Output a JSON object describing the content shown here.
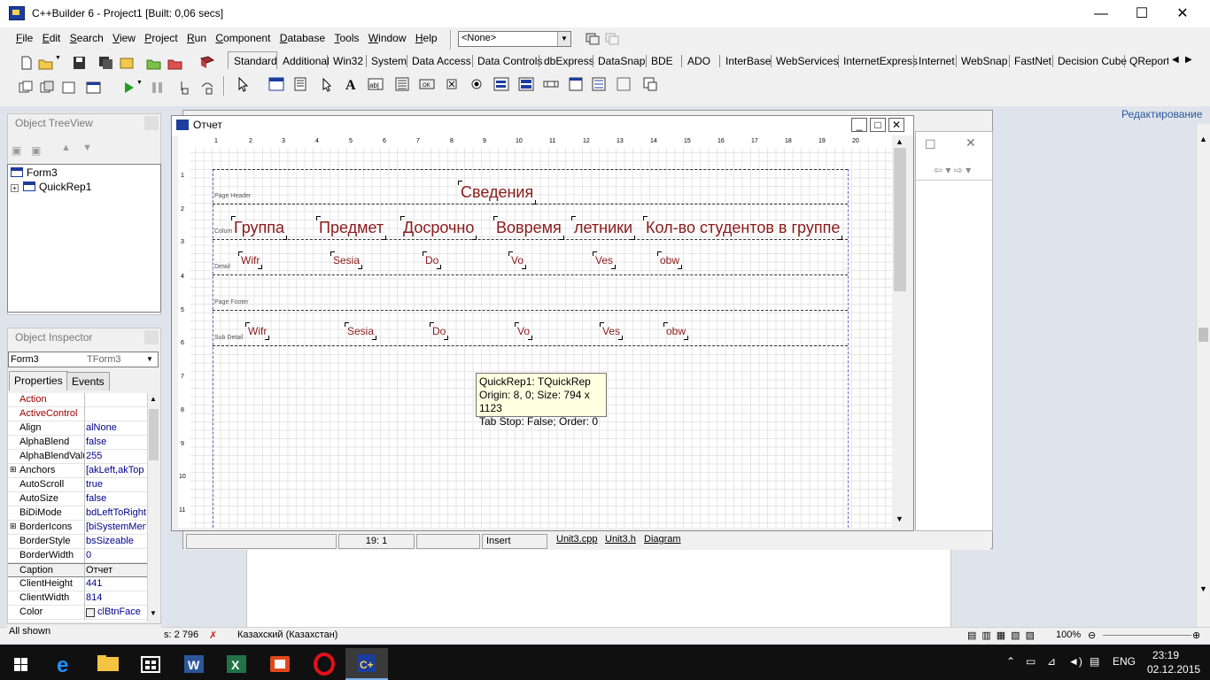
{
  "app": {
    "title": "C++Builder 6 - Project1 [Built: 0,06 secs]"
  },
  "window_buttons": {
    "minimize": "—",
    "maximize": "☐",
    "close": "✕"
  },
  "menu": [
    {
      "label": "File",
      "key": "F",
      "rest": "ile"
    },
    {
      "label": "Edit",
      "key": "E",
      "rest": "dit"
    },
    {
      "label": "Search",
      "key": "S",
      "rest": "earch"
    },
    {
      "label": "View",
      "key": "V",
      "rest": "iew"
    },
    {
      "label": "Project",
      "key": "P",
      "rest": "roject"
    },
    {
      "label": "Run",
      "key": "R",
      "rest": "un"
    },
    {
      "label": "Component",
      "key": "C",
      "rest": "omponent"
    },
    {
      "label": "Database",
      "key": "D",
      "rest": "atabase"
    },
    {
      "label": "Tools",
      "key": "T",
      "rest": "ools"
    },
    {
      "label": "Window",
      "key": "W",
      "rest": "indow"
    },
    {
      "label": "Help",
      "key": "H",
      "rest": "elp"
    }
  ],
  "config_combo": "<None>",
  "palette_tabs": [
    "Standard",
    "Additional",
    "Win32",
    "System",
    "Data Access",
    "Data Controls",
    "dbExpress",
    "DataSnap",
    "BDE",
    "ADO",
    "InterBase",
    "WebServices",
    "InternetExpress",
    "Internet",
    "WebSnap",
    "FastNet",
    "Decision Cube",
    "QReport"
  ],
  "treeview": {
    "title": "Object TreeView",
    "nodes": [
      "Form3",
      "QuickRep1"
    ]
  },
  "inspector": {
    "title": "Object Inspector",
    "object": "Form3",
    "object_type": "TForm3",
    "tabs": [
      "Properties",
      "Events"
    ],
    "props": [
      {
        "name": "Action",
        "value": "",
        "event": true
      },
      {
        "name": "ActiveControl",
        "value": "",
        "event": true
      },
      {
        "name": "Align",
        "value": "alNone"
      },
      {
        "name": "AlphaBlend",
        "value": "false"
      },
      {
        "name": "AlphaBlendValu",
        "value": "255"
      },
      {
        "name": "Anchors",
        "value": "[akLeft,akTop",
        "expandable": true
      },
      {
        "name": "AutoScroll",
        "value": "true"
      },
      {
        "name": "AutoSize",
        "value": "false"
      },
      {
        "name": "BiDiMode",
        "value": "bdLeftToRight"
      },
      {
        "name": "BorderIcons",
        "value": "[biSystemMen",
        "expandable": true
      },
      {
        "name": "BorderStyle",
        "value": "bsSizeable"
      },
      {
        "name": "BorderWidth",
        "value": "0"
      },
      {
        "name": "Caption",
        "value": "Отчет",
        "selected": true
      },
      {
        "name": "ClientHeight",
        "value": "441"
      },
      {
        "name": "ClientWidth",
        "value": "814"
      },
      {
        "name": "Color",
        "value": "clBtnFace"
      }
    ],
    "footer": "All shown"
  },
  "report_form": {
    "title": "Отчет",
    "ruler_top": [
      "1",
      "2",
      "3",
      "4",
      "5",
      "6",
      "7",
      "8",
      "9",
      "10",
      "11",
      "12",
      "13",
      "14",
      "15",
      "16",
      "17",
      "18",
      "19",
      "20"
    ],
    "ruler_left": [
      "1",
      "2",
      "3",
      "4",
      "5",
      "6",
      "7",
      "8",
      "9",
      "10",
      "11"
    ],
    "bands": {
      "page_header": "Page Header",
      "column_header": "Colum",
      "detail": "Detail",
      "page_footer": "Page Footer",
      "sub_detail": "Sub Detail"
    },
    "title_label": "Сведения",
    "column_labels": [
      "Группа",
      "Предмет",
      "Досрочно",
      "Вовремя",
      "летники",
      "Кол-во студентов в группе"
    ],
    "detail_fields": [
      "Wifr",
      "Sesia",
      "Do",
      "Vo",
      "Ves",
      "obw"
    ],
    "subdetail_fields": [
      "Wifr",
      "Sesia",
      "Do",
      "Vo",
      "Ves",
      "obw"
    ],
    "tooltip": {
      "line1": "QuickRep1: TQuickRep",
      "line2": "Origin: 8, 0; Size: 794 x 1123",
      "line3": "Tab Stop: False; Order: 0"
    }
  },
  "editor_status": {
    "position": "19:   1",
    "mode": "Insert",
    "tabs": [
      "Unit3.cpp",
      "Unit3.h",
      "Diagram"
    ]
  },
  "word": {
    "ribbon_group": "Редактирование",
    "status_words": "s: 2 796",
    "language": "Казахский (Казахстан)",
    "zoom": "100%"
  },
  "taskbar": {
    "language": "ENG",
    "time": "23:19",
    "date": "02.12.2015"
  },
  "colors": {
    "label_text": "#8b1a1a",
    "word_accent": "#2b579a",
    "taskbar": "#101010"
  }
}
